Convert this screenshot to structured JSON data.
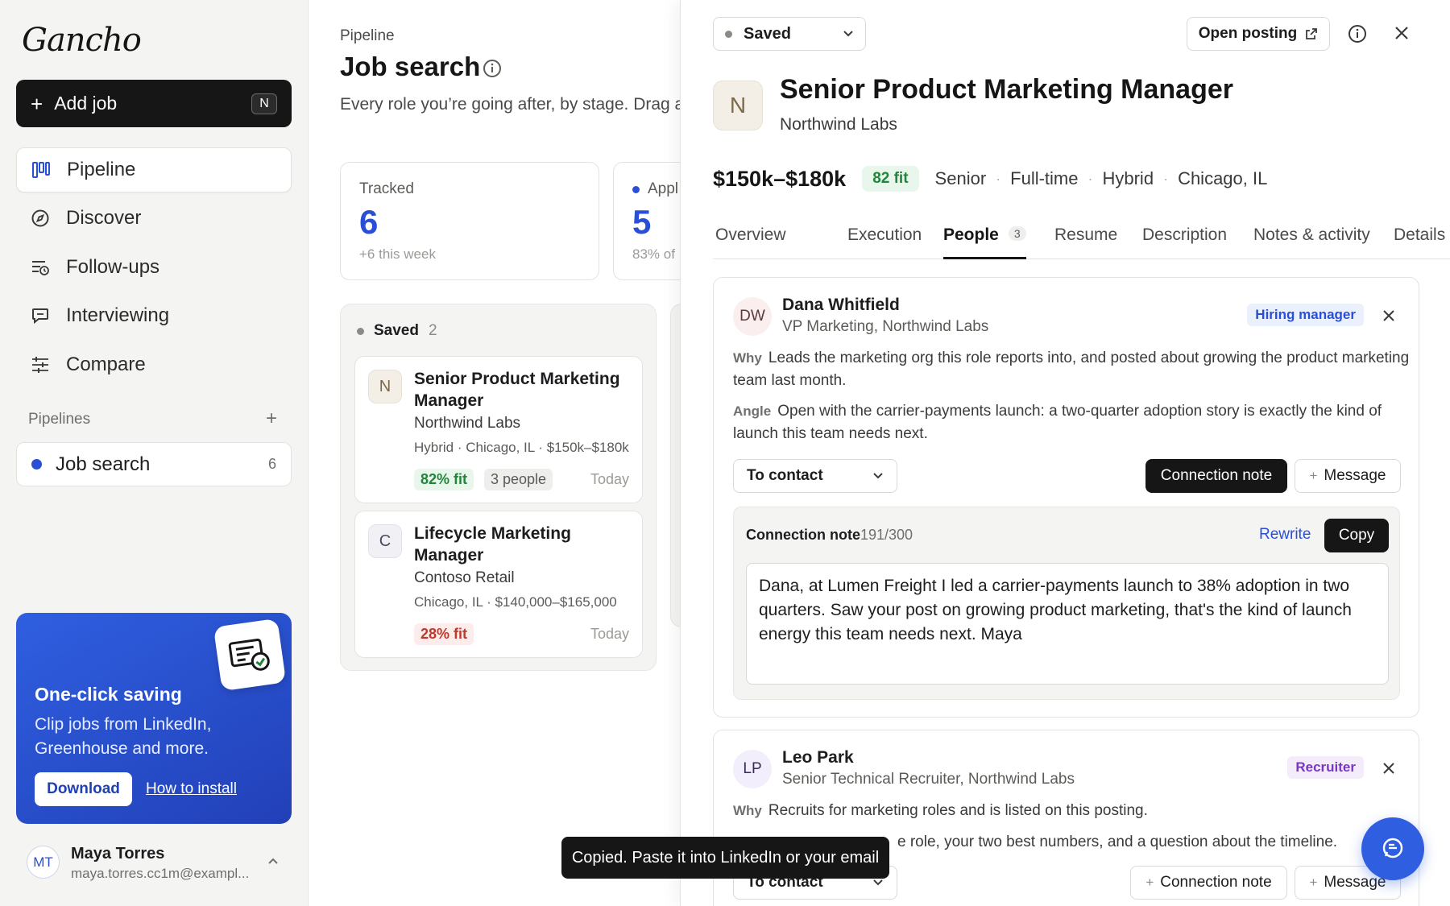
{
  "app": {
    "logo_text": "Gancho"
  },
  "sidebar": {
    "add_job_label": "Add job",
    "add_job_shortcut": "N",
    "nav": [
      {
        "label": "Pipeline",
        "icon": "board-icon",
        "active": true
      },
      {
        "label": "Discover",
        "icon": "compass-icon"
      },
      {
        "label": "Follow-ups",
        "icon": "list-clock-icon"
      },
      {
        "label": "Interviewing",
        "icon": "chat-icon"
      },
      {
        "label": "Compare",
        "icon": "sliders-icon"
      }
    ],
    "pipelines_label": "Pipelines",
    "pipeline_item": {
      "label": "Job search",
      "count": "6"
    },
    "promo": {
      "title": "One-click saving",
      "body": "Clip jobs from LinkedIn, Greenhouse and more.",
      "download_label": "Download",
      "howto_label": "How to install"
    },
    "user": {
      "initials": "MT",
      "name": "Maya Torres",
      "email": "maya.torres.cc1m@exampl..."
    }
  },
  "main": {
    "breadcrumb": "Pipeline",
    "title": "Job search",
    "subtitle": "Every role you’re going after, by stage. Drag a",
    "stats": [
      {
        "label": "Tracked",
        "value": "6",
        "sub": "+6 this week"
      },
      {
        "label": "Appl",
        "value": "5",
        "sub": "83% of"
      }
    ],
    "column": {
      "name": "Saved",
      "count": "2",
      "cards": [
        {
          "logo": "N",
          "title": "Senior Product Marketing Manager",
          "company": "Northwind Labs",
          "meta": "Hybrid · Chicago, IL · $150k–$180k",
          "fit": "82% fit",
          "people": "3 people",
          "date": "Today"
        },
        {
          "logo": "C",
          "title": "Lifecycle Marketing Manager",
          "company": "Contoso Retail",
          "meta": "Chicago, IL · $140,000–$165,000",
          "fit": "28% fit",
          "date": "Today"
        }
      ]
    }
  },
  "panel": {
    "status": "Saved",
    "open_posting_label": "Open posting",
    "job": {
      "logo": "N",
      "title": "Senior Product Marketing Manager",
      "company": "Northwind Labs",
      "salary": "$150k–$180k",
      "fit": "82 fit",
      "level": "Senior",
      "type": "Full-time",
      "mode": "Hybrid",
      "location": "Chicago, IL"
    },
    "tabs": [
      {
        "label": "Overview"
      },
      {
        "label": "Execution"
      },
      {
        "label": "People",
        "count": "3",
        "active": true
      },
      {
        "label": "Resume"
      },
      {
        "label": "Description"
      },
      {
        "label": "Notes & activity"
      },
      {
        "label": "Details"
      }
    ],
    "people": [
      {
        "initials": "DW",
        "name": "Dana Whitfield",
        "title": "VP Marketing, Northwind Labs",
        "role": "Hiring manager",
        "why_label": "Why",
        "why": "Leads the marketing org this role reports into, and posted about growing the product marketing team last month.",
        "angle_label": "Angle",
        "angle": "Open with the carrier-payments launch: a two-quarter adoption story is exactly the kind of launch this team needs next.",
        "contact_status": "To contact",
        "connection_note_label": "Connection note",
        "message_label": "Message",
        "note": {
          "label": "Connection note",
          "count": "191/300",
          "rewrite_label": "Rewrite",
          "copy_label": "Copy",
          "text": "Dana, at Lumen Freight I led a carrier-payments launch to 38% adoption in two quarters. Saw your post on growing product marketing, that's the kind of launch energy this team needs next. Maya"
        }
      },
      {
        "initials": "LP",
        "name": "Leo Park",
        "title": "Senior Technical Recruiter, Northwind Labs",
        "role": "Recruiter",
        "why_label": "Why",
        "why": "Recruits for marketing roles and is listed on this posting.",
        "angle_tail": "e role, your two best numbers, and a question about the timeline.",
        "contact_status": "To contact",
        "connection_note_label": "Connection note",
        "message_label": "Message"
      }
    ]
  },
  "toast": "Copied. Paste it into LinkedIn or your email",
  "colors": {
    "accent": "#2a4fd7",
    "dark": "#161616",
    "fit_green": "#22863a",
    "fit_red": "#c0392b"
  }
}
